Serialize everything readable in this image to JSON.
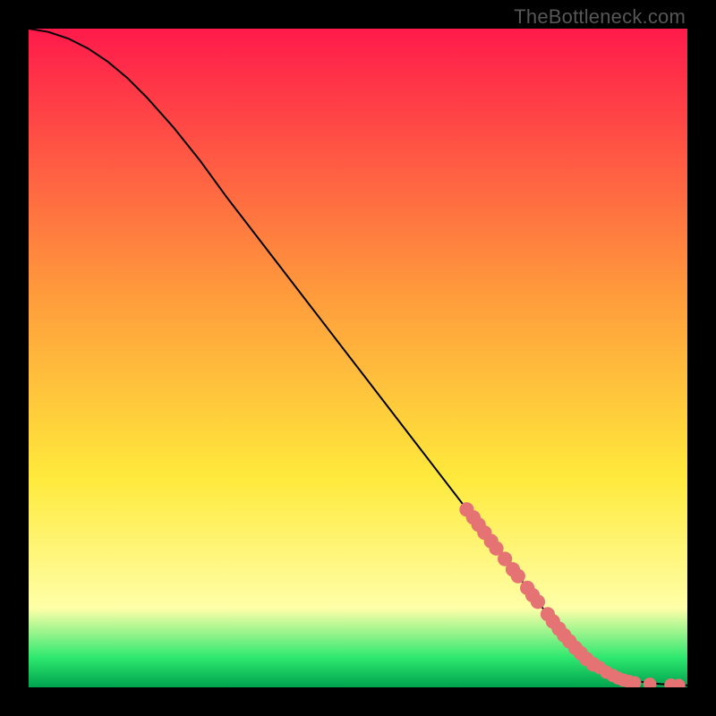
{
  "watermark": "TheBottleneck.com",
  "colors": {
    "frame": "#000000",
    "curve": "#000000",
    "marker_fill": "#e57373",
    "marker_stroke": "#a64a4a",
    "grad_top": "#ff1a4b",
    "grad_mid_orange": "#ff9a3c",
    "grad_yellow": "#ffe93b",
    "grad_pale_yellow": "#ffffa8",
    "grad_green": "#2ee86f",
    "grad_deep_green": "#00a24e"
  },
  "chart_data": {
    "type": "line",
    "title": "",
    "xlabel": "",
    "ylabel": "",
    "xlim": [
      0,
      100
    ],
    "ylim": [
      0,
      100
    ],
    "series": [
      {
        "name": "curve",
        "x": [
          0,
          3,
          6,
          9,
          12,
          15,
          18,
          22,
          26,
          30,
          35,
          40,
          45,
          50,
          55,
          60,
          65,
          70,
          75,
          80,
          83,
          86,
          88,
          90,
          92,
          94,
          96,
          98,
          99,
          100
        ],
        "y": [
          100,
          99.5,
          98.5,
          97,
          95,
          92.5,
          89.5,
          85,
          80,
          74.5,
          68,
          61.5,
          55,
          48.5,
          42,
          35.5,
          29,
          22.5,
          16,
          9.5,
          6.3,
          3.8,
          2.5,
          1.6,
          1.0,
          0.7,
          0.5,
          0.4,
          0.35,
          0.3
        ]
      }
    ],
    "markers": [
      {
        "x": 66.5,
        "y": 27.0,
        "r": 1.1
      },
      {
        "x": 67.5,
        "y": 25.8,
        "r": 1.1
      },
      {
        "x": 68.3,
        "y": 24.7,
        "r": 1.1
      },
      {
        "x": 69.2,
        "y": 23.5,
        "r": 1.1
      },
      {
        "x": 70.2,
        "y": 22.2,
        "r": 1.1
      },
      {
        "x": 71.0,
        "y": 21.1,
        "r": 1.1
      },
      {
        "x": 72.3,
        "y": 19.5,
        "r": 1.1
      },
      {
        "x": 73.5,
        "y": 17.9,
        "r": 1.1
      },
      {
        "x": 74.3,
        "y": 16.9,
        "r": 1.1
      },
      {
        "x": 75.7,
        "y": 15.1,
        "r": 1.1
      },
      {
        "x": 76.5,
        "y": 14.0,
        "r": 1.1
      },
      {
        "x": 77.3,
        "y": 13.0,
        "r": 1.1
      },
      {
        "x": 78.8,
        "y": 11.1,
        "r": 1.1
      },
      {
        "x": 79.6,
        "y": 10.0,
        "r": 1.1
      },
      {
        "x": 80.5,
        "y": 8.9,
        "r": 1.1
      },
      {
        "x": 81.3,
        "y": 7.9,
        "r": 1.1
      },
      {
        "x": 82.1,
        "y": 7.0,
        "r": 1.1
      },
      {
        "x": 83.0,
        "y": 6.0,
        "r": 1.1
      },
      {
        "x": 83.8,
        "y": 5.2,
        "r": 1.1
      },
      {
        "x": 84.7,
        "y": 4.3,
        "r": 1.1
      },
      {
        "x": 85.7,
        "y": 3.5,
        "r": 1.1
      },
      {
        "x": 86.7,
        "y": 3.0,
        "r": 1.0
      },
      {
        "x": 87.7,
        "y": 2.3,
        "r": 1.0
      },
      {
        "x": 88.7,
        "y": 1.8,
        "r": 1.0
      },
      {
        "x": 89.5,
        "y": 1.4,
        "r": 1.0
      },
      {
        "x": 90.3,
        "y": 1.1,
        "r": 1.0
      },
      {
        "x": 91.1,
        "y": 0.9,
        "r": 1.0
      },
      {
        "x": 92.0,
        "y": 0.7,
        "r": 1.0
      },
      {
        "x": 94.3,
        "y": 0.5,
        "r": 1.0
      },
      {
        "x": 97.5,
        "y": 0.35,
        "r": 1.0
      },
      {
        "x": 98.7,
        "y": 0.3,
        "r": 1.0
      }
    ],
    "gradient_stops": [
      {
        "offset": 0.0,
        "color_key": "grad_top"
      },
      {
        "offset": 0.4,
        "color_key": "grad_mid_orange"
      },
      {
        "offset": 0.68,
        "color_key": "grad_yellow"
      },
      {
        "offset": 0.88,
        "color_key": "grad_pale_yellow"
      },
      {
        "offset": 0.955,
        "color_key": "grad_green"
      },
      {
        "offset": 1.0,
        "color_key": "grad_deep_green"
      }
    ]
  }
}
